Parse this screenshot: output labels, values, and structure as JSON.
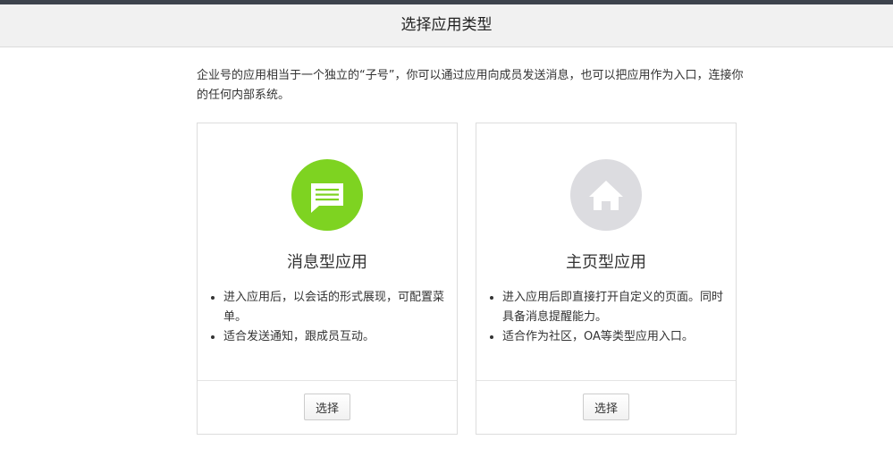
{
  "header": {
    "title": "选择应用类型"
  },
  "intro": {
    "text": "企业号的应用相当于一个独立的“子号”，你可以通过应用向成员发送消息，也可以把应用作为入口，连接你的任何内部系统。"
  },
  "cards": [
    {
      "title": "消息型应用",
      "icon": "message-icon",
      "icon_color": "#7ed321",
      "features": [
        "进入应用后，以会话的形式展现，可配置菜单。",
        "适合发送通知，跟成员互动。"
      ],
      "button_label": "选择"
    },
    {
      "title": "主页型应用",
      "icon": "home-icon",
      "icon_color": "#dcdce0",
      "features": [
        "进入应用后即直接打开自定义的页面。同时具备消息提醒能力。",
        "适合作为社区，OA等类型应用入口。"
      ],
      "button_label": "选择"
    }
  ],
  "colors": {
    "topbar": "#3d434d",
    "header_bg": "#f1f1f1",
    "message_icon_bg": "#7ed321",
    "home_icon_bg": "#dcdce0"
  }
}
